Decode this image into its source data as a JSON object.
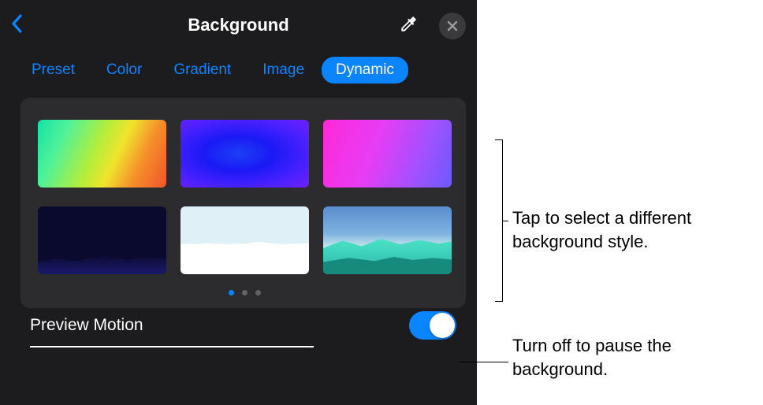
{
  "header": {
    "title": "Background"
  },
  "tabs": [
    {
      "label": "Preset",
      "active": false
    },
    {
      "label": "Color",
      "active": false
    },
    {
      "label": "Gradient",
      "active": false
    },
    {
      "label": "Image",
      "active": false
    },
    {
      "label": "Dynamic",
      "active": true
    }
  ],
  "thumbnails": [
    {
      "name": "dynamic-bg-rainbow"
    },
    {
      "name": "dynamic-bg-blue"
    },
    {
      "name": "dynamic-bg-pink-purple"
    },
    {
      "name": "dynamic-bg-dark-hills"
    },
    {
      "name": "dynamic-bg-white-sky"
    },
    {
      "name": "dynamic-bg-teal-mountains"
    }
  ],
  "pagination": {
    "pages": 3,
    "current": 0
  },
  "preview_motion": {
    "label": "Preview Motion",
    "on": true
  },
  "callouts": {
    "styles": "Tap to select a different background style.",
    "toggle": "Turn off to pause the background."
  }
}
